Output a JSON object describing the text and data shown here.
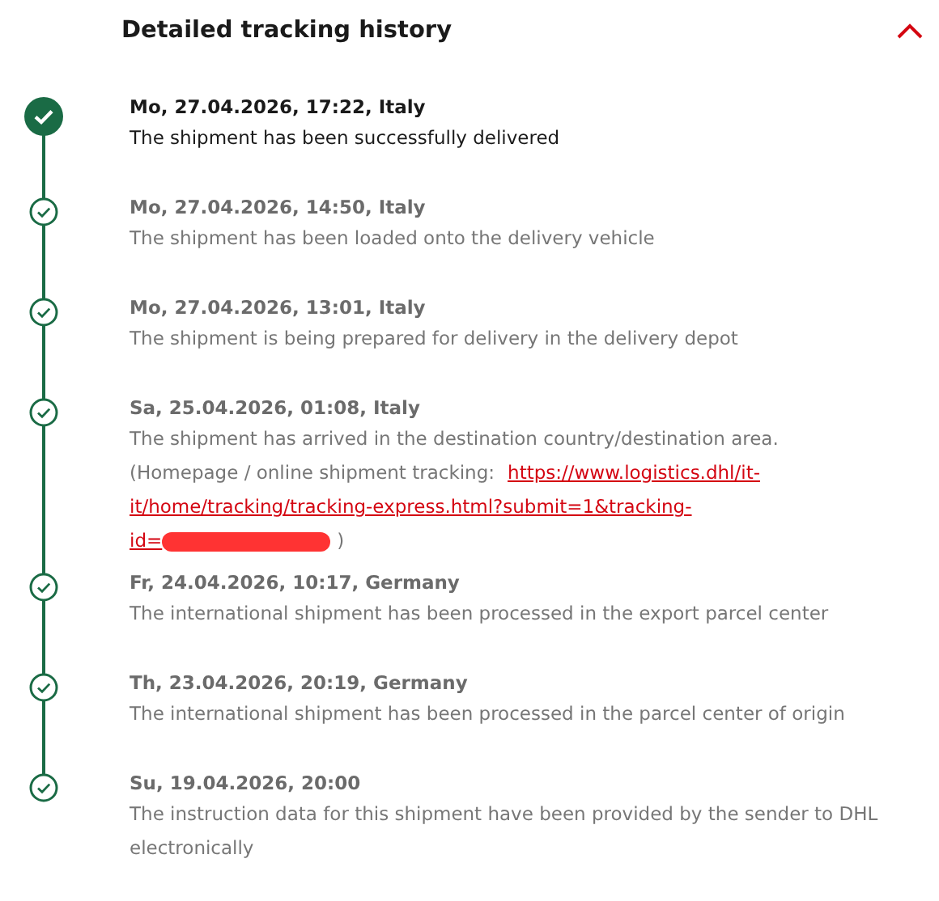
{
  "section": {
    "title": "Detailed tracking history",
    "expanded": true
  },
  "events": [
    {
      "datetime": "Mo, 27.04.2026, 17:22, Italy",
      "description": "The shipment has been successfully delivered",
      "current": true
    },
    {
      "datetime": "Mo, 27.04.2026, 14:50, Italy",
      "description": "The shipment has been loaded onto the delivery vehicle",
      "current": false
    },
    {
      "datetime": "Mo, 27.04.2026, 13:01, Italy",
      "description": "The shipment is being prepared for delivery in the delivery depot",
      "current": false
    },
    {
      "datetime": "Sa, 25.04.2026, 01:08, Italy",
      "description": "The shipment has arrived in the destination country/destination area.",
      "note": {
        "prefix": "(Homepage / online shipment tracking:",
        "link_lines": [
          "https://www.logistics.dhl/it-",
          "it/home/tracking/tracking-express.html?submit=1&tracking-",
          "id="
        ],
        "redacted": true,
        "suffix": ")"
      },
      "current": false
    },
    {
      "datetime": "Fr, 24.04.2026, 10:17, Germany",
      "description": "The international shipment has been processed in the export parcel center",
      "current": false
    },
    {
      "datetime": "Th, 23.04.2026, 20:19, Germany",
      "description": "The international shipment has been processed in the parcel center of origin",
      "current": false
    },
    {
      "datetime": "Su, 19.04.2026, 20:00",
      "description": "The instruction data for this shipment have been provided by the sender to DHL electronically",
      "current": false
    }
  ]
}
